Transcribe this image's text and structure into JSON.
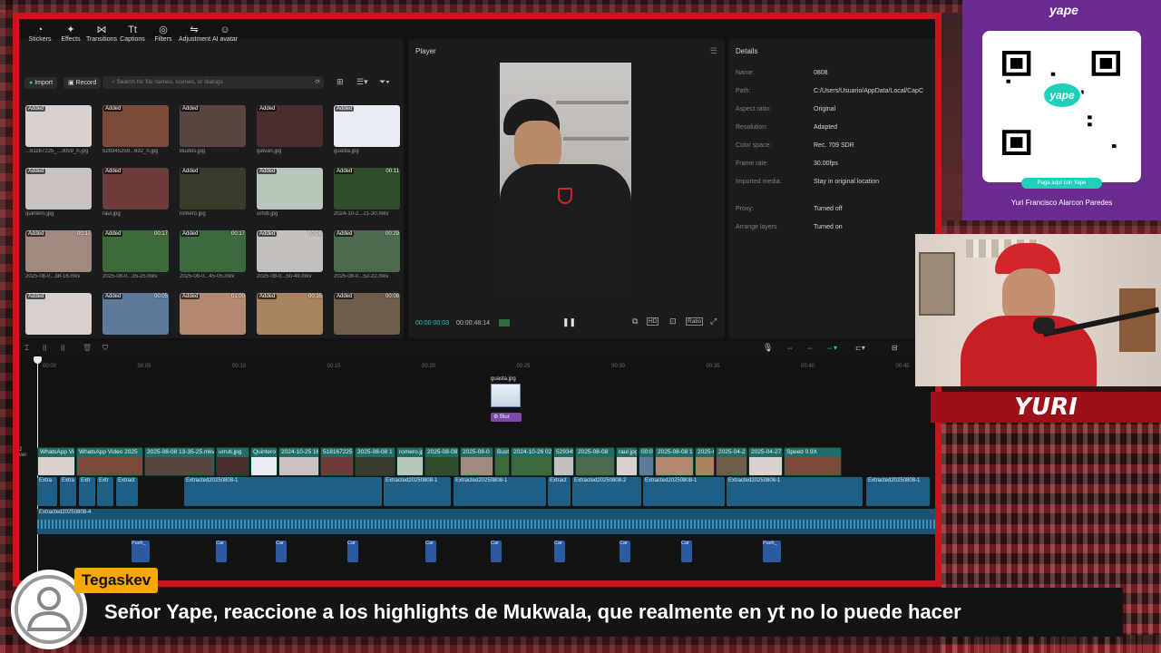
{
  "toolbar": {
    "tools": [
      {
        "label": "Stickers",
        "icon": "sticker-icon"
      },
      {
        "label": "Effects",
        "icon": "effects-icon"
      },
      {
        "label": "Transitions",
        "icon": "transitions-icon"
      },
      {
        "label": "Captions",
        "icon": "captions-icon"
      },
      {
        "label": "Filters",
        "icon": "filters-icon"
      },
      {
        "label": "Adjustment",
        "icon": "adjustment-icon"
      },
      {
        "label": "AI avatar",
        "icon": "ai-avatar-icon"
      }
    ],
    "import_label": "Import",
    "record_label": "Record",
    "search_placeholder": "Search for file names, scenes, or dialogs"
  },
  "media": {
    "badge": "Added",
    "items": [
      {
        "name": "...61167225_...3059_n.jpg",
        "duration": ""
      },
      {
        "name": "529345259...632_n.jpg",
        "duration": ""
      },
      {
        "name": "Bustos.jpg",
        "duration": ""
      },
      {
        "name": "galvan.jpg",
        "duration": ""
      },
      {
        "name": "guasta.jpg",
        "duration": ""
      },
      {
        "name": "quintero.jpg",
        "duration": ""
      },
      {
        "name": "raul.jpg",
        "duration": ""
      },
      {
        "name": "romero.jpg",
        "duration": ""
      },
      {
        "name": "urruti.jpg",
        "duration": ""
      },
      {
        "name": "2024-10-2...21-30.mkv",
        "duration": "00:11"
      },
      {
        "name": "2025-08-0...38-16.mkv",
        "duration": "00:17"
      },
      {
        "name": "2025-08-0...35-25.mkv",
        "duration": "00:17"
      },
      {
        "name": "2025-08-0...45-05.mkv",
        "duration": "00:17"
      },
      {
        "name": "2025-08-0...50-49.mkv",
        "duration": "00:08"
      },
      {
        "name": "2025-08-0...52-22.mkv",
        "duration": "00:29"
      },
      {
        "name": "",
        "duration": ""
      },
      {
        "name": "",
        "duration": "00:05"
      },
      {
        "name": "",
        "duration": "01:00"
      },
      {
        "name": "",
        "duration": "00:35"
      },
      {
        "name": "",
        "duration": "00:08"
      }
    ]
  },
  "player": {
    "title": "Player",
    "current_time": "00:00:00:03",
    "total_time": "00:00:48:14",
    "ratio_label": "Ratio"
  },
  "details": {
    "title": "Details",
    "rows": [
      {
        "key": "Name:",
        "value": "0808"
      },
      {
        "key": "Path:",
        "value": "C:/Users/Usuario/AppData/Local/CapC"
      },
      {
        "key": "Aspect ratio:",
        "value": "Original"
      },
      {
        "key": "Resolution:",
        "value": "Adapted"
      },
      {
        "key": "Color space:",
        "value": "Rec. 709 SDR"
      },
      {
        "key": "Frame rate:",
        "value": "30.00fps"
      },
      {
        "key": "Imported media:",
        "value": "Stay in original location"
      },
      {
        "key": "Proxy:",
        "value": "Turned off"
      },
      {
        "key": "Arrange layers",
        "value": "Turned on"
      }
    ]
  },
  "timeline": {
    "ticks": [
      "00:00",
      "00:05",
      "00:10",
      "00:15",
      "00:20",
      "00:25",
      "00:30",
      "00:35",
      "00:40",
      "00:45"
    ],
    "overlay_clip": "guasta.jpg",
    "overlay_effect": "Blur",
    "video_clips": [
      "WhatsApp Vid",
      "WhatsApp Video 2025",
      "2025-08-08 13-35-25.mkv",
      "urruti.jpg",
      "Quintero",
      "2024-10-25 16",
      "518167225",
      "2025-08-08 1",
      "romero.jpg",
      "2025-08-08",
      "2025-08-0",
      "Busto",
      "2024-10-26 02-1",
      "529345",
      "2025-08-08",
      "raul.jpg",
      "00:00",
      "2025-08-08 13",
      "2025-0",
      "2025-04-2",
      "2025-04-27",
      "Speed 0.9X"
    ],
    "audio_clips": [
      "Extra",
      "Extra",
      "Extr",
      "Extr",
      "Extract",
      "Extracted20250808-1",
      "Extracted20250808-1",
      "Extracted20250808-1",
      "Extract",
      "Extracted20250808-2",
      "Extracted20250808-1",
      "Extracted20250808-1",
      "Extracted20250808-1"
    ],
    "music_clip": "Extracted20250808-4",
    "sfx_clips": [
      "Push_",
      "Car",
      "Car",
      "Car",
      "Car",
      "Car",
      "Car",
      "Car",
      "Car",
      "Push_"
    ]
  },
  "yape": {
    "brand": "yape",
    "pill": "Paga aquí con Yape",
    "owner": "Yuri Francisco Alarcon Paredes"
  },
  "webcam": {
    "name": "YURI"
  },
  "chat": {
    "user": "Tegaskev",
    "message": "Señor Yape, reaccione a los highlights de Mukwala, que realmente en yt no lo puede hacer"
  },
  "colors": {
    "frame_red": "#c8161f",
    "yape_purple": "#6b2a8f",
    "chat_gold": "#f6a800",
    "timeline_teal": "#1e6d68",
    "audio_blue": "#1f5f86"
  }
}
